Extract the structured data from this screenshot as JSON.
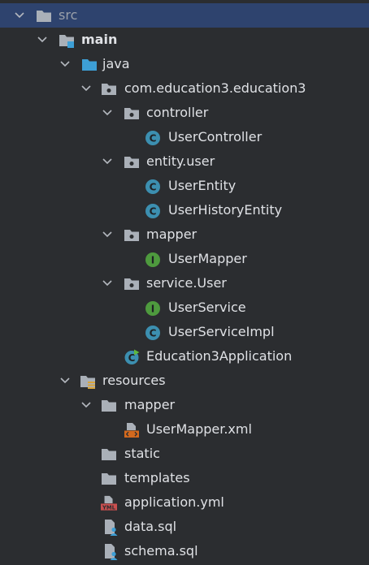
{
  "project_tree": {
    "src": {
      "label": "src",
      "icon": "folder-icon"
    },
    "main": {
      "label": "main",
      "icon": "source-root-folder-icon"
    },
    "java": {
      "label": "java",
      "icon": "java-sources-folder-icon"
    },
    "package_root": {
      "label": "com.education3.education3",
      "icon": "package-icon"
    },
    "controller": {
      "label": "controller",
      "icon": "package-icon"
    },
    "user_controller": {
      "label": "UserController",
      "icon": "class-icon"
    },
    "entity_user": {
      "label": "entity.user",
      "icon": "package-icon"
    },
    "user_entity": {
      "label": "UserEntity",
      "icon": "class-icon"
    },
    "user_history_entity": {
      "label": "UserHistoryEntity",
      "icon": "class-icon"
    },
    "mapper_pkg": {
      "label": "mapper",
      "icon": "package-icon"
    },
    "user_mapper": {
      "label": "UserMapper",
      "icon": "interface-icon"
    },
    "service_user": {
      "label": "service.User",
      "icon": "package-icon"
    },
    "user_service": {
      "label": "UserService",
      "icon": "interface-icon"
    },
    "user_service_impl": {
      "label": "UserServiceImpl",
      "icon": "class-icon"
    },
    "application_class": {
      "label": "Education3Application",
      "icon": "spring-boot-class-icon"
    },
    "resources": {
      "label": "resources",
      "icon": "resources-folder-icon"
    },
    "mapper_res": {
      "label": "mapper",
      "icon": "folder-icon"
    },
    "user_mapper_xml": {
      "label": "UserMapper.xml",
      "icon": "xml-file-icon"
    },
    "static": {
      "label": "static",
      "icon": "folder-icon"
    },
    "templates": {
      "label": "templates",
      "icon": "folder-icon"
    },
    "application_yml": {
      "label": "application.yml",
      "icon": "yml-file-icon",
      "badge": "YML"
    },
    "data_sql": {
      "label": "data.sql",
      "icon": "sql-file-icon"
    },
    "schema_sql": {
      "label": "schema.sql",
      "icon": "sql-file-icon"
    }
  },
  "icon_letters": {
    "class": "C",
    "interface": "I"
  },
  "colors": {
    "background": "#2b2d30",
    "selection": "#2e436e",
    "text": "#dfe1e5",
    "folder": "#aab0b8",
    "source_folder": "#3d9fd6",
    "class_icon": "#3c8fb0",
    "interface_icon": "#4e9a3e",
    "xml_badge": "#d2691e",
    "yml_badge": "#c94f4f"
  }
}
